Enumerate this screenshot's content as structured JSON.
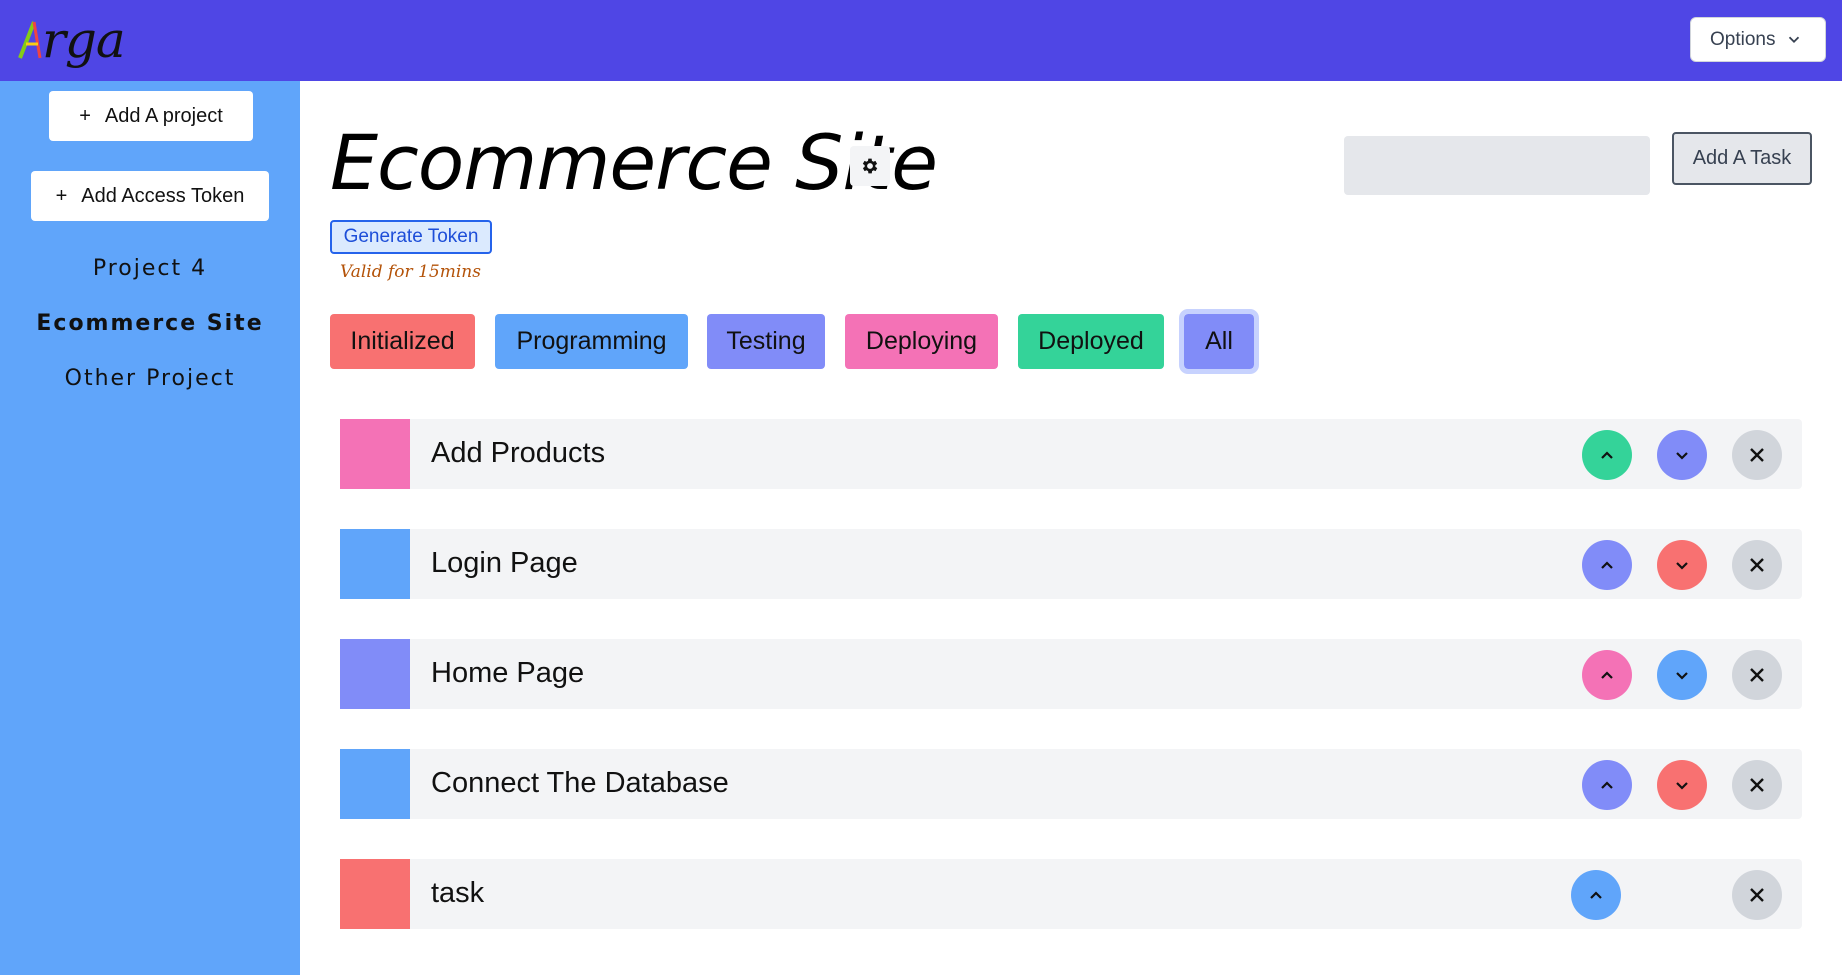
{
  "app": {
    "logo_text": "rga",
    "options_label": "Options"
  },
  "sidebar": {
    "add_project_label": "Add A project",
    "add_token_label": "Add Access Token",
    "plus_glyph": "+",
    "projects": [
      {
        "name": "Project 4",
        "active": false
      },
      {
        "name": "Ecommerce Site",
        "active": true
      },
      {
        "name": "Other Project",
        "active": false
      }
    ]
  },
  "main": {
    "title": "Ecommerce Site",
    "generate_token_label": "Generate Token",
    "valid_note": "Valid for 15mins",
    "search_value": "",
    "add_task_label": "Add A Task",
    "filters": [
      {
        "label": "Initialized",
        "color": "#f87171"
      },
      {
        "label": "Programming",
        "color": "#60a5fa"
      },
      {
        "label": "Testing",
        "color": "#818cf8"
      },
      {
        "label": "Deploying",
        "color": "#f472b6"
      },
      {
        "label": "Deployed",
        "color": "#34d399"
      },
      {
        "label": "All",
        "color": "#818cf8"
      }
    ],
    "tasks": [
      {
        "title": "Add Products",
        "status_color": "#f472b6",
        "up_color": "#34d399",
        "down_color": "#818cf8",
        "has_down": true
      },
      {
        "title": "Login Page",
        "status_color": "#60a5fa",
        "up_color": "#818cf8",
        "down_color": "#f87171",
        "has_down": true
      },
      {
        "title": "Home Page",
        "status_color": "#818cf8",
        "up_color": "#f472b6",
        "down_color": "#60a5fa",
        "has_down": true
      },
      {
        "title": "Connect The Database",
        "status_color": "#60a5fa",
        "up_color": "#818cf8",
        "down_color": "#f87171",
        "has_down": true
      },
      {
        "title": "task",
        "status_color": "#f87171",
        "up_color": "#60a5fa",
        "down_color": "",
        "has_down": false
      }
    ],
    "delete_color": "#d1d5db"
  },
  "colors": {
    "topbar": "#4f46e5",
    "sidebar": "#60a5fa",
    "row_bg": "#f3f4f6"
  },
  "icons": {
    "options": "chevron-down-icon",
    "title_action": "gear-icon",
    "task_up": "chevron-up-icon",
    "task_down": "chevron-down-icon",
    "task_delete": "close-icon"
  }
}
